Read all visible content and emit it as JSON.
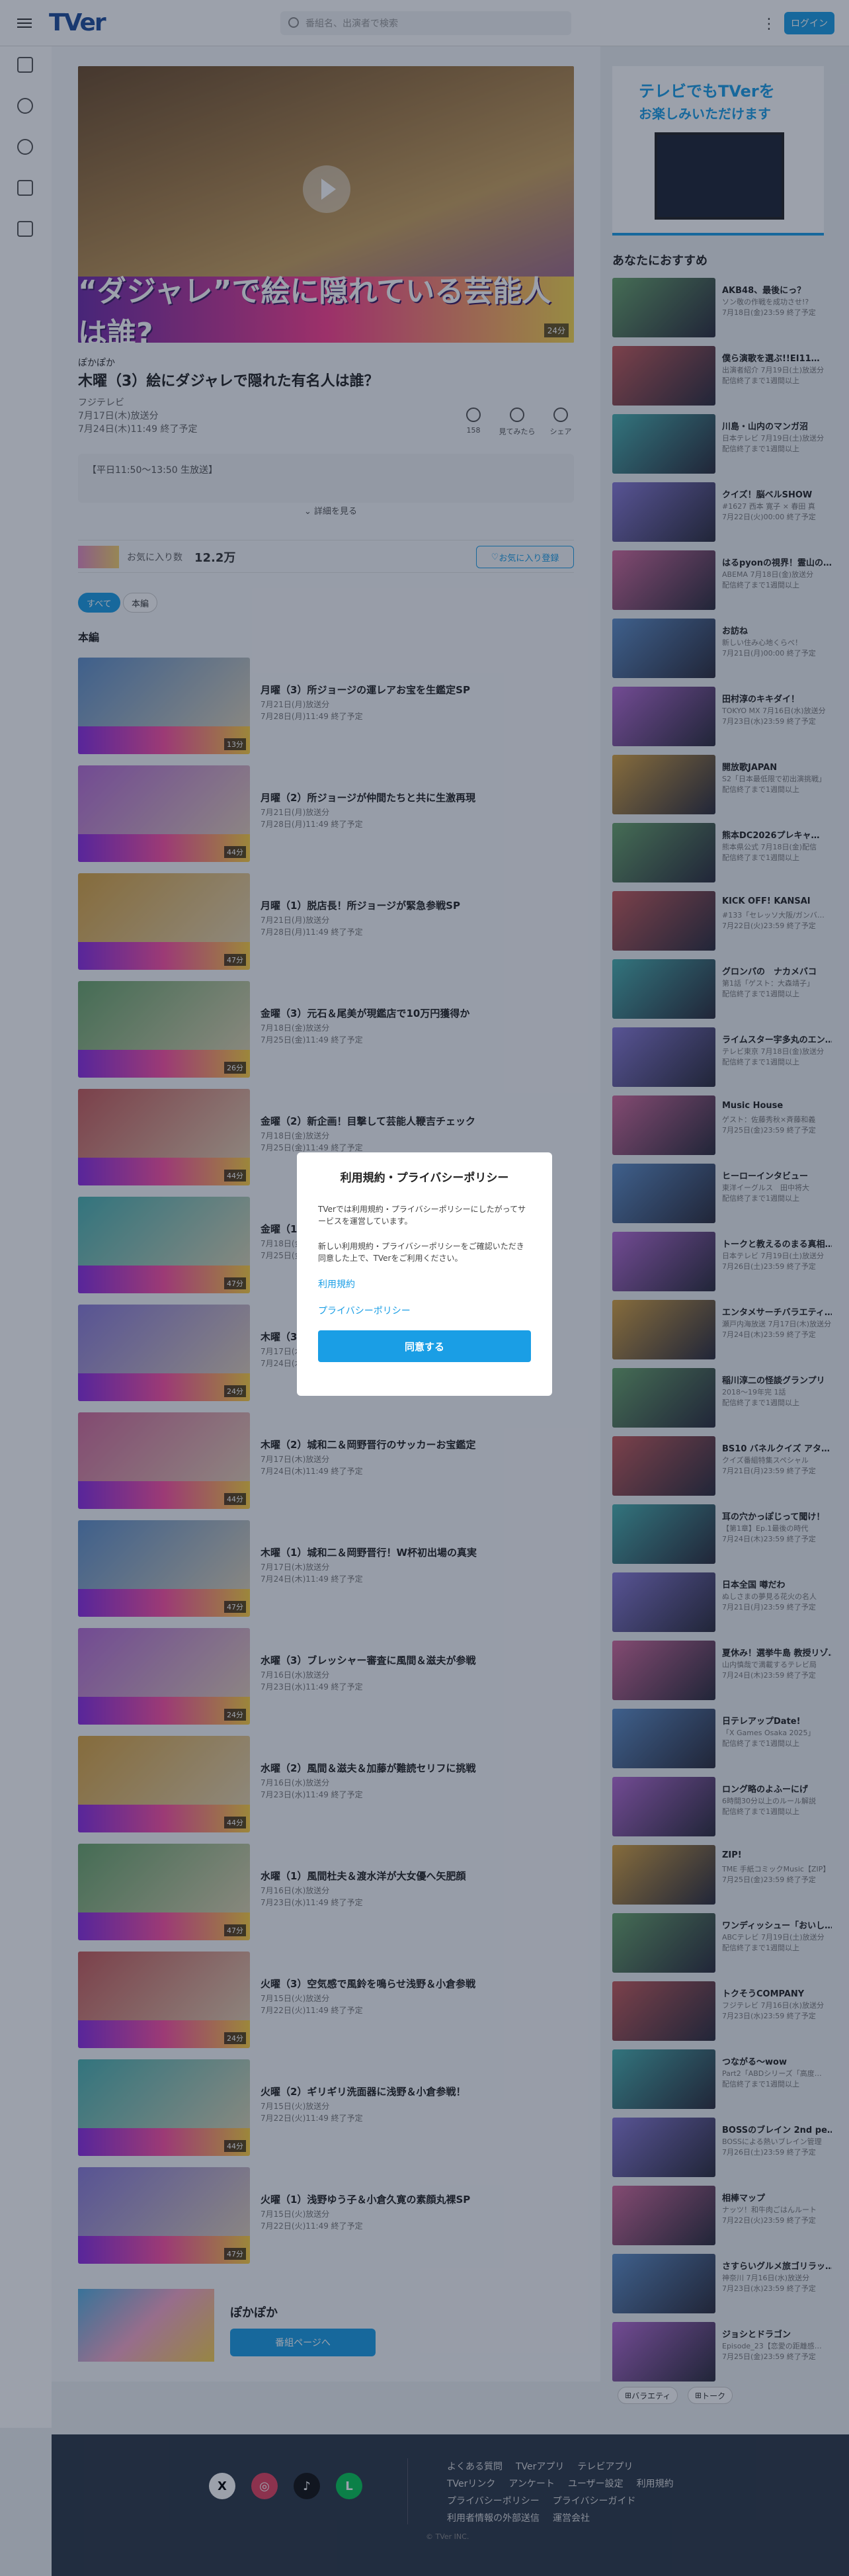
{
  "header": {
    "logo": "TVer",
    "search_placeholder": "番組名、出演者で検索",
    "login": "ログイン"
  },
  "hero": {
    "title": "“ダジャレ”で絵に隠れている芸能人は誰?",
    "duration": "24分"
  },
  "episode": {
    "series": "ぽかぽか",
    "title": "木曜（3）絵にダジャレで隠れた有名人は誰？",
    "channel": "フジテレビ",
    "air": "7月17日(木)放送分",
    "expire": "7月24日(木)11:49 終了予定",
    "like_count": "158",
    "action_tried": "見てみたら",
    "action_share": "シェア",
    "desc": "【平日11:50～13:50 生放送】",
    "more": "詳細を見る"
  },
  "fav": {
    "label": "お気に入り数",
    "count": "12.2万",
    "button": "お気に入り登録"
  },
  "chips": [
    "すべて",
    "本編"
  ],
  "section": "本編",
  "episodes": [
    {
      "title": "月曜（3）所ジョージの運レアお宝を生鑑定SP",
      "air": "7月21日(月)放送分",
      "exp": "7月28日(月)11:49 終了予定",
      "dur": "13分"
    },
    {
      "title": "月曜（2）所ジョージが仲間たちと共に生激再現",
      "air": "7月21日(月)放送分",
      "exp": "7月28日(月)11:49 終了予定",
      "dur": "44分"
    },
    {
      "title": "月曜（1）脱店長！所ジョージが緊急参戦SP",
      "air": "7月21日(月)放送分",
      "exp": "7月28日(月)11:49 終了予定",
      "dur": "47分"
    },
    {
      "title": "金曜（3）元石＆尾美が現鑑店で10万円獲得か",
      "air": "7月18日(金)放送分",
      "exp": "7月25日(金)11:49 終了予定",
      "dur": "26分"
    },
    {
      "title": "金曜（2）新企画！目撃して芸能人鞭吉チェック",
      "air": "7月18日(金)放送分",
      "exp": "7月25日(金)11:49 終了予定",
      "dur": "44分"
    },
    {
      "title": "金曜（1）",
      "air": "7月18日(金)放送分",
      "exp": "7月25日(金)11:49 終了予定",
      "dur": "47分"
    },
    {
      "title": "木曜（3）",
      "air": "7月17日(木)放送分",
      "exp": "7月24日(木)11:49 終了予定",
      "dur": "24分"
    },
    {
      "title": "木曜（2）城和二＆岡野晋行のサッカーお宝鑑定",
      "air": "7月17日(木)放送分",
      "exp": "7月24日(木)11:49 終了予定",
      "dur": "44分"
    },
    {
      "title": "木曜（1）城和二＆岡野晋行！W杯初出場の真実",
      "air": "7月17日(木)放送分",
      "exp": "7月24日(木)11:49 終了予定",
      "dur": "47分"
    },
    {
      "title": "水曜（3）ブレッシャー審査に風間＆滋夫が参戦",
      "air": "7月16日(水)放送分",
      "exp": "7月23日(水)11:49 終了予定",
      "dur": "24分"
    },
    {
      "title": "水曜（2）風間＆滋夫＆加藤が難読セリフに挑戦",
      "air": "7月16日(水)放送分",
      "exp": "7月23日(水)11:49 終了予定",
      "dur": "44分"
    },
    {
      "title": "水曜（1）風間杜夫＆渡水洋が大女優へ矢肥顔",
      "air": "7月16日(水)放送分",
      "exp": "7月23日(水)11:49 終了予定",
      "dur": "47分"
    },
    {
      "title": "火曜（3）空気感で風鈴を鳴らせ浅野＆小倉参戦",
      "air": "7月15日(火)放送分",
      "exp": "7月22日(火)11:49 終了予定",
      "dur": "24分"
    },
    {
      "title": "火曜（2）ギリギリ洗面器に浅野＆小倉参戦！",
      "air": "7月15日(火)放送分",
      "exp": "7月22日(火)11:49 終了予定",
      "dur": "44分"
    },
    {
      "title": "火曜（1）浅野ゆう子＆小倉久寛の素顔丸裸SP",
      "air": "7月15日(火)放送分",
      "exp": "7月22日(火)11:49 終了予定",
      "dur": "47分"
    }
  ],
  "series_footer": {
    "name": "ぽかぽか",
    "button": "番組ページへ"
  },
  "banner": {
    "line1": "テレビでもTVerを",
    "line2": "お楽しみいただけます"
  },
  "recommend_title": "あなたにおすすめ",
  "recommend": [
    {
      "t": "AKB48、最後にっ？",
      "s1": "ソン敬の作戦を成功させ!?",
      "s2": "7月18日(金)23:59 終了予定"
    },
    {
      "t": "僕ら演歌を選ぶ!!EI11…",
      "s1": "出演者紹介 7月19日(土)放送分",
      "s2": "配信終了まで1週間以上"
    },
    {
      "t": "川島・山内のマンガ沼",
      "s1": "日本テレビ 7月19日(土)放送分",
      "s2": "配信終了まで1週間以上"
    },
    {
      "t": "クイズ！脳ベルSHOW",
      "s1": "#1627 西本 寛子 × 春田 真",
      "s2": "7月22日(火)00:00 終了予定"
    },
    {
      "t": "はるpyonの視界！霊山の…",
      "s1": "ABEMA 7月18日(金)放送分",
      "s2": "配信終了まで1週間以上"
    },
    {
      "t": "お訪ね",
      "s1": "新しい住み心地くらべ！",
      "s2": "7月21日(月)00:00 終了予定"
    },
    {
      "t": "田村淳のキキダイ！",
      "s1": "TOKYO MX 7月16日(水)放送分",
      "s2": "7月23日(水)23:59 終了予定"
    },
    {
      "t": "開放歌JAPAN",
      "s1": "S2「日本最低限で初出演挑戦」",
      "s2": "配信終了まで1週間以上"
    },
    {
      "t": "熊本DC2026プレキャ…",
      "s1": "熊本県公式 7月18日(金)配信",
      "s2": "配信終了まで1週間以上"
    },
    {
      "t": "KICK OFF! KANSAI",
      "s1": "#133「セレッソ大阪/ガンバ…",
      "s2": "7月22日(火)23:59 終了予定"
    },
    {
      "t": "グロンパの　ナカメバコ",
      "s1": "第1話「ゲスト：大森靖子」",
      "s2": "配信終了まで1週間以上"
    },
    {
      "t": "ライムスター宇多丸のエン…",
      "s1": "テレビ東京 7月18日(金)放送分",
      "s2": "配信終了まで1週間以上"
    },
    {
      "t": "Music House",
      "s1": "ゲスト：佐藤秀秋×斉藤和義",
      "s2": "7月25日(金)23:59 終了予定"
    },
    {
      "t": "ヒーローインタビュー",
      "s1": "東洋イーグルス　田中将大",
      "s2": "配信終了まで1週間以上"
    },
    {
      "t": "トークと教えるのまる真相…",
      "s1": "日本テレビ 7月19日(土)放送分",
      "s2": "7月26日(土)23:59 終了予定"
    },
    {
      "t": "エンタメサーチバラエティ…",
      "s1": "瀬戸内海放送 7月17日(木)放送分",
      "s2": "7月24日(木)23:59 終了予定"
    },
    {
      "t": "稲川淳二の怪談グランプリ",
      "s1": "2018〜19年完 1話",
      "s2": "配信終了まで1週間以上"
    },
    {
      "t": "BS10 バネルクイズ アタ…",
      "s1": "クイズ番組特集スペシャル",
      "s2": "7月21日(月)23:59 終了予定"
    },
    {
      "t": "耳の穴かっぽじって聞け！",
      "s1": "【第1章】Ep.1最後の時代",
      "s2": "7月24日(木)23:59 終了予定"
    },
    {
      "t": "日本全国 噂だわ",
      "s1": "ぬしさまの夢見る花火の名人",
      "s2": "7月21日(月)23:59 終了予定"
    },
    {
      "t": "夏休み！選挙牛島 教授リゾ…",
      "s1": "山内慎哉で満載するテレビ局",
      "s2": "7月24日(木)23:59 終了予定"
    },
    {
      "t": "日テレアップDate!",
      "s1": "「X Games Osaka 2025」",
      "s2": "配信終了まで1週間以上"
    },
    {
      "t": "ロング略のよふーにげ",
      "s1": "6時間30分以上のルール解説",
      "s2": "配信終了まで1週間以上"
    },
    {
      "t": "ZIP!",
      "s1": "TME 手紙コミックMusic【ZIP】",
      "s2": "7月25日(金)23:59 終了予定"
    },
    {
      "t": "ワンディッシュー「おいし…",
      "s1": "ABCテレビ 7月19日(土)放送分",
      "s2": "配信終了まで1週間以上"
    },
    {
      "t": "トクそうCOMPANY",
      "s1": "フジテレビ 7月16日(水)放送分",
      "s2": "7月23日(水)23:59 終了予定"
    },
    {
      "t": "つながる〜wow",
      "s1": "Part2「ABDシリーズ「高度…",
      "s2": "配信終了まで1週間以上"
    },
    {
      "t": "BOSSのブレイン 2nd pe…",
      "s1": "BOSSによる熱いブレイン管理",
      "s2": "7月26日(土)23:59 終了予定"
    },
    {
      "t": "相棒マップ",
      "s1": "ナッツ！和牛肉ごはんルート",
      "s2": "7月22日(火)23:59 終了予定"
    },
    {
      "t": "さすらいグルメ旅ゴリラッ…",
      "s1": "神奈川 7月16日(水)放送分",
      "s2": "7月23日(水)23:59 終了予定"
    },
    {
      "t": "ジョシとドラゴン",
      "s1": "Episode_23【恋愛の距離感…",
      "s2": "7月25日(金)23:59 終了予定"
    }
  ],
  "tags": [
    "バラエティ",
    "トーク"
  ],
  "footer": {
    "links": [
      "よくある質問",
      "TVerアプリ",
      "テレビアプリ",
      "TVerリンク",
      "アンケート",
      "ユーザー設定",
      "利用規約",
      "プライバシーポリシー",
      "プライバシーガイド",
      "利用者情報の外部送信",
      "運営会社"
    ],
    "copyright": "© TVer INC."
  },
  "modal": {
    "title": "利用規約・プライバシーポリシー",
    "p1": "TVerでは利用規約・プライバシーポリシーにしたがってサービスを運営しています。",
    "p2": "新しい利用規約・プライバシーポリシーをご確認いただき同意した上で、TVerをご利用ください。",
    "link1": "利用規約",
    "link2": "プライバシーポリシー",
    "agree": "同意する"
  }
}
